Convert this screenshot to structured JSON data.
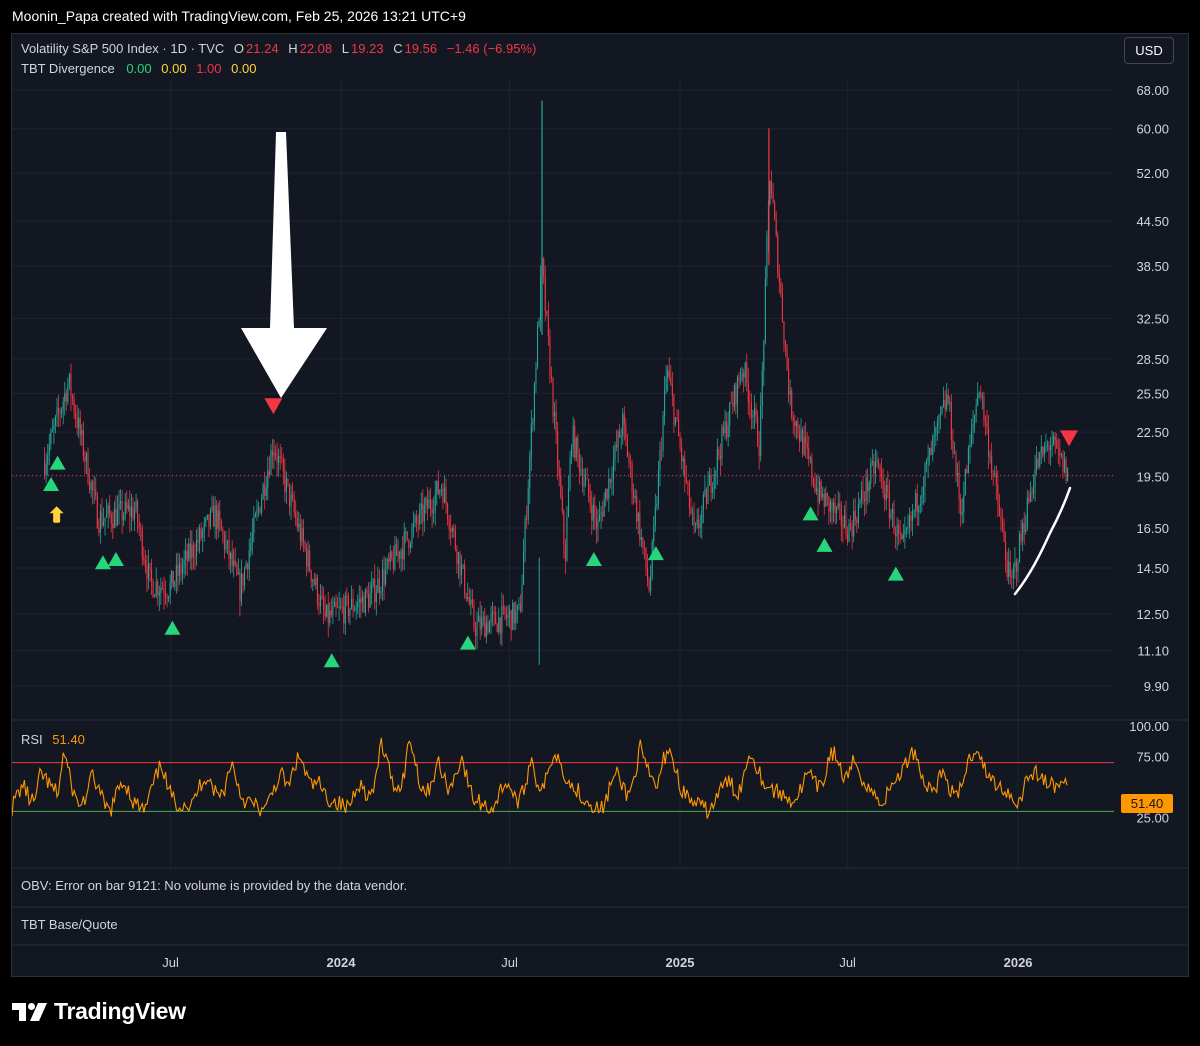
{
  "header": {
    "text": "Moonin_Papa created with TradingView.com, Feb 25, 2026 13:21 UTC+9"
  },
  "legend": {
    "symbol": "Volatility S&P 500 Index · 1D · TVC",
    "o_label": "O",
    "o_value": "21.24",
    "h_label": "H",
    "h_value": "22.08",
    "l_label": "L",
    "l_value": "19.23",
    "c_label": "C",
    "c_value": "19.56",
    "change": "−1.46 (−6.95%)",
    "indicator": "TBT Divergence",
    "ind_values": [
      "0.00",
      "0.00",
      "1.00",
      "0.00"
    ],
    "ind_colors": [
      "#26d67c",
      "#ffd43b",
      "#f23645",
      "#ffd43b"
    ]
  },
  "currency": "USD",
  "rsi": {
    "label": "RSI",
    "value": "51.40",
    "badge": "51.40"
  },
  "obv": {
    "text": "OBV: Error on bar 9121: No volume is provided by the data vendor."
  },
  "tbt_base_quote": {
    "text": "TBT Base/Quote"
  },
  "brand": {
    "name": "TradingView"
  },
  "colors": {
    "up": "#26a69a",
    "down": "#f23645",
    "rsi": "#ff9800",
    "bull_marker": "#26d67c",
    "bear_marker": "#f23645",
    "divergence": "#ffd43b"
  },
  "chart_data": [
    {
      "type": "candlestick",
      "title": "Volatility S&P 500 Index · 1D · TVC",
      "scale": "log",
      "ylim": [
        9.9,
        68.0
      ],
      "y_ticks": [
        "68.00",
        "60.00",
        "52.00",
        "44.50",
        "38.50",
        "32.50",
        "28.50",
        "25.50",
        "22.50",
        "19.50",
        "16.50",
        "14.50",
        "12.50",
        "11.10",
        "9.90"
      ],
      "x_ticks": [
        {
          "label": "Jul",
          "date": "2023-07-01"
        },
        {
          "label": "2024",
          "date": "2024-01-01"
        },
        {
          "label": "Jul",
          "date": "2024-07-01"
        },
        {
          "label": "2025",
          "date": "2025-01-01"
        },
        {
          "label": "Jul",
          "date": "2025-07-01"
        },
        {
          "label": "2026",
          "date": "2026-01-01"
        }
      ],
      "last_close": 19.56,
      "price_path": [
        {
          "date": "2023-02-15",
          "value": 20.5
        },
        {
          "date": "2023-03-13",
          "value": 26.5
        },
        {
          "date": "2023-04-14",
          "value": 17.0
        },
        {
          "date": "2023-05-24",
          "value": 17.5
        },
        {
          "date": "2023-06-09",
          "value": 13.8
        },
        {
          "date": "2023-06-30",
          "value": 13.6
        },
        {
          "date": "2023-08-18",
          "value": 17.3
        },
        {
          "date": "2023-09-14",
          "value": 13.5
        },
        {
          "date": "2023-10-20",
          "value": 21.7
        },
        {
          "date": "2023-12-15",
          "value": 12.3
        },
        {
          "date": "2024-02-01",
          "value": 13.2
        },
        {
          "date": "2024-04-19",
          "value": 19.0
        },
        {
          "date": "2024-05-24",
          "value": 12.0
        },
        {
          "date": "2024-07-12",
          "value": 12.5
        },
        {
          "date": "2024-08-05",
          "value": 38.5
        },
        {
          "date": "2024-08-30",
          "value": 15.0
        },
        {
          "date": "2024-09-06",
          "value": 22.4
        },
        {
          "date": "2024-10-04",
          "value": 16.5
        },
        {
          "date": "2024-10-31",
          "value": 23.2
        },
        {
          "date": "2024-11-29",
          "value": 13.5
        },
        {
          "date": "2024-12-18",
          "value": 27.6
        },
        {
          "date": "2025-01-17",
          "value": 16.0
        },
        {
          "date": "2025-03-10",
          "value": 27.9
        },
        {
          "date": "2025-03-28",
          "value": 21.6
        },
        {
          "date": "2025-04-08",
          "value": 52.3
        },
        {
          "date": "2025-04-30",
          "value": 24.7
        },
        {
          "date": "2025-05-30",
          "value": 18.5
        },
        {
          "date": "2025-07-03",
          "value": 16.4
        },
        {
          "date": "2025-08-01",
          "value": 20.4
        },
        {
          "date": "2025-08-29",
          "value": 15.3
        },
        {
          "date": "2025-10-17",
          "value": 25.3
        },
        {
          "date": "2025-10-31",
          "value": 17.4
        },
        {
          "date": "2025-11-20",
          "value": 26.4
        },
        {
          "date": "2025-12-24",
          "value": 13.6
        },
        {
          "date": "2026-01-20",
          "value": 20.1
        },
        {
          "date": "2026-02-05",
          "value": 21.8
        },
        {
          "date": "2026-02-24",
          "value": 19.56
        }
      ],
      "spikes_high": [
        {
          "date": "2024-08-05",
          "value": 65.7
        },
        {
          "date": "2025-04-07",
          "value": 60.1
        }
      ],
      "bullish_divergence_markers": [
        "2023-02-22",
        "2023-03-01",
        "2023-04-19",
        "2023-05-03",
        "2023-07-03",
        "2023-12-22",
        "2024-05-17",
        "2024-09-30",
        "2024-12-06",
        "2025-05-22",
        "2025-06-06",
        "2025-08-22"
      ],
      "bearish_divergence_markers": [
        "2023-10-20",
        "2026-02-25"
      ],
      "divergence_alert_markers": [
        "2023-02-28"
      ]
    },
    {
      "type": "line",
      "title": "RSI",
      "ylim": [
        0,
        100
      ],
      "y_ticks": [
        "100.00",
        "75.00",
        "25.00"
      ],
      "bands": {
        "upper": 70,
        "lower": 30
      },
      "last_value": 51.4,
      "series": [
        {
          "values": [
            33,
            45,
            52,
            40,
            38,
            62,
            55,
            48,
            45,
            80,
            58,
            40,
            35,
            44,
            60,
            48,
            35,
            30,
            42,
            55,
            50,
            38,
            34,
            30,
            45,
            58,
            70,
            48,
            40,
            35,
            38,
            32,
            45,
            55,
            60,
            48,
            42,
            50,
            72,
            55,
            40,
            38,
            35,
            32,
            30,
            45,
            55,
            60,
            48,
            68,
            75,
            60,
            50,
            55,
            45,
            40,
            38,
            36,
            32,
            40,
            55,
            48,
            42,
            50,
            88,
            70,
            55,
            48,
            60,
            92,
            70,
            50,
            45,
            58,
            70,
            55,
            48,
            62,
            75,
            55,
            40,
            38,
            35,
            32,
            38,
            50,
            55,
            42,
            38,
            50,
            76,
            55,
            48,
            60,
            80,
            72,
            60,
            50,
            48,
            42,
            38,
            35,
            30,
            38,
            55,
            60,
            50,
            42,
            60,
            82,
            65,
            55,
            50,
            72,
            84,
            65,
            50,
            42,
            38,
            35,
            32,
            30,
            40,
            48,
            55,
            50,
            45,
            60,
            80,
            70,
            58,
            50,
            48,
            45,
            42,
            40,
            40,
            50,
            62,
            55,
            48,
            58,
            80,
            75,
            60,
            55,
            72,
            65,
            50,
            48,
            40,
            38,
            45,
            55,
            60,
            68,
            80,
            76,
            55,
            50,
            48,
            60,
            58,
            45,
            40,
            58,
            72,
            82,
            78,
            60,
            55,
            52,
            48,
            45,
            38,
            40,
            58,
            62,
            60,
            56,
            52,
            50,
            54,
            51.4
          ]
        }
      ]
    }
  ]
}
